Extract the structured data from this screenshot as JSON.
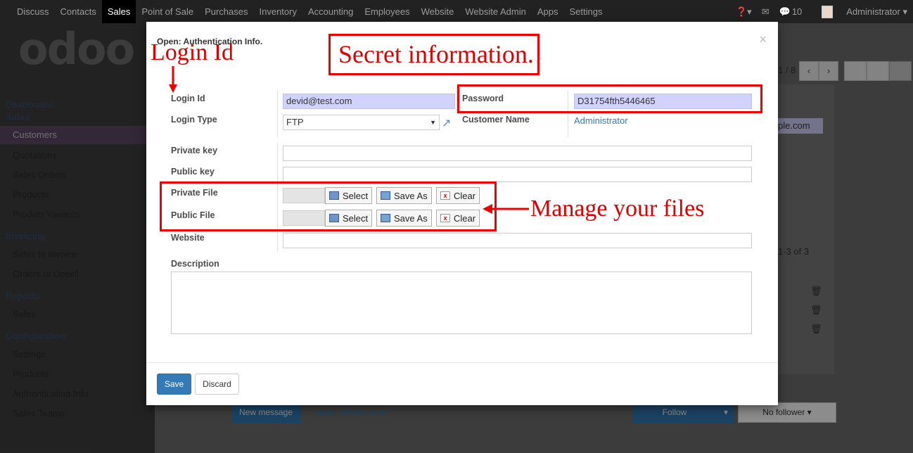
{
  "topbar": {
    "menu": [
      "Discuss",
      "Contacts",
      "Sales",
      "Point of Sale",
      "Purchases",
      "Inventory",
      "Accounting",
      "Employees",
      "Website",
      "Website Admin",
      "Apps",
      "Settings"
    ],
    "active": "Sales",
    "help_icon": "?",
    "messages_count": "10",
    "user": "Administrator"
  },
  "sidebar": {
    "logo": "odoo",
    "sections": [
      {
        "title": "Dashboard"
      },
      {
        "title": "Sales"
      },
      {
        "title": "Invoicing"
      },
      {
        "title": "Reports"
      },
      {
        "title": "Configuration"
      }
    ],
    "items": [
      "Customers",
      "Quotations",
      "Sales Orders",
      "Products",
      "Product Variants",
      "Sales to Invoice",
      "Orders to Upsell",
      "Sales",
      "Settings",
      "Products",
      "Authentication Info.",
      "Sales Teams"
    ]
  },
  "background": {
    "pager": "1 / 8",
    "email_fragment": "ple.com",
    "records": "1-3 of 3",
    "new_message": "New message",
    "log_note": "Log an internal note",
    "follow": "Follow",
    "no_follower": "No follower"
  },
  "modal": {
    "title": "Open: Authentication Info.",
    "close": "×",
    "fields": {
      "login_id_label": "Login Id",
      "login_id_value": "devid@test.com",
      "password_label": "Password",
      "password_value": "D31754fth5446465",
      "login_type_label": "Login Type",
      "login_type_value": "FTP",
      "customer_name_label": "Customer Name",
      "customer_name_value": "Administrator",
      "private_key_label": "Private key",
      "public_key_label": "Public key",
      "private_file_label": "Private File",
      "public_file_label": "Public File",
      "website_label": "Website",
      "description_label": "Description"
    },
    "file_buttons": {
      "select": "Select",
      "save_as": "Save As",
      "clear": "Clear"
    },
    "save": "Save",
    "discard": "Discard"
  },
  "annotations": {
    "login_id": "Login Id",
    "secret": "Secret information.",
    "files": "Manage your files"
  },
  "colors": {
    "annotation": "#dd0000",
    "primary": "#337ab7",
    "required_field": "#d2d2ff"
  }
}
